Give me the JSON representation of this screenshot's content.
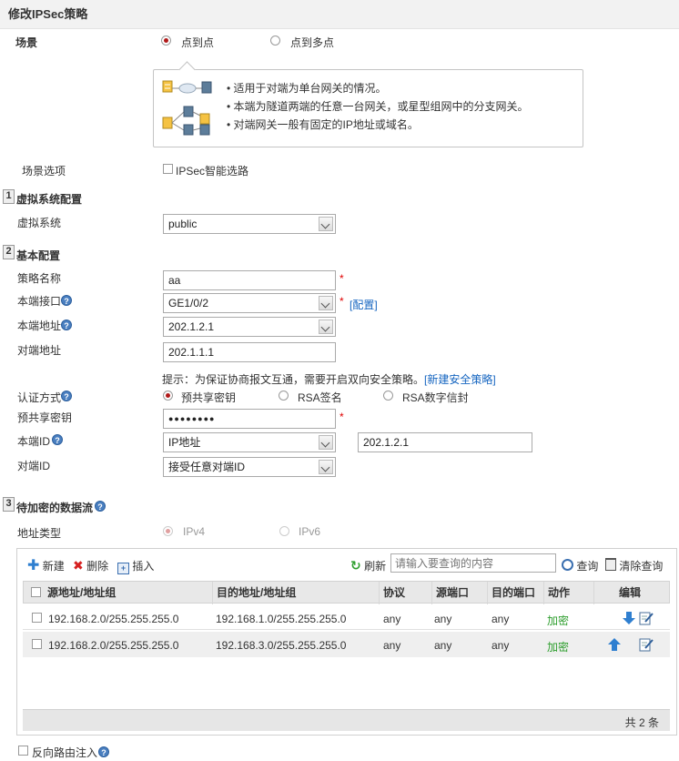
{
  "page_title": "修改IPSec策略",
  "scene": {
    "label": "场景",
    "options": [
      {
        "label": "点到点",
        "selected": true
      },
      {
        "label": "点到多点",
        "selected": false
      }
    ],
    "info_lines": [
      "适用于对端为单台网关的情况。",
      "本端为隧道两端的任意一台网关，或星型组网中的分支网关。",
      "对端网关一般有固定的IP地址或域名。"
    ]
  },
  "scene_option": {
    "label": "场景选项",
    "checkbox_label": "IPSec智能选路",
    "checked": false
  },
  "section1": {
    "num": "1",
    "title": "虚拟系统配置",
    "vsys_label": "虚拟系统",
    "vsys_value": "public"
  },
  "section2": {
    "num": "2",
    "title": "基本配置",
    "policy_name_label": "策略名称",
    "policy_name_value": "aa",
    "local_if_label": "本端接口",
    "local_if_value": "GE1/0/2",
    "config_link": "[配置]",
    "local_addr_label": "本端地址",
    "local_addr_value": "202.1.2.1",
    "peer_addr_label": "对端地址",
    "peer_addr_value": "202.1.1.1",
    "hint_text": "提示：为保证协商报文互通，需要开启双向安全策略。",
    "hint_link": "[新建安全策略]",
    "auth_label": "认证方式",
    "auth_options": [
      {
        "label": "预共享密钥",
        "selected": true
      },
      {
        "label": "RSA签名",
        "selected": false
      },
      {
        "label": "RSA数字信封",
        "selected": false
      }
    ],
    "psk_label": "预共享密钥",
    "psk_value": "●●●●●●●●",
    "local_id_label": "本端ID",
    "local_id_type": "IP地址",
    "local_id_value": "202.1.2.1",
    "peer_id_label": "对端ID",
    "peer_id_value": "接受任意对端ID",
    "required_mark": "*"
  },
  "section3": {
    "num": "3",
    "title": "待加密的数据流",
    "addr_type_label": "地址类型",
    "addr_type_options": [
      {
        "label": "IPv4",
        "selected": true
      },
      {
        "label": "IPv6",
        "selected": false
      }
    ],
    "toolbar": {
      "new_label": "新建",
      "delete_label": "删除",
      "insert_label": "插入",
      "refresh_label": "刷新",
      "search_placeholder": "请输入要查询的内容",
      "query_label": "查询",
      "clear_query_label": "清除查询"
    },
    "table": {
      "headers": [
        "源地址/地址组",
        "目的地址/地址组",
        "协议",
        "源端口",
        "目的端口",
        "动作",
        "编辑"
      ],
      "rows": [
        {
          "src": "192.168.2.0/255.255.255.0",
          "dst": "192.168.1.0/255.255.255.0",
          "proto": "any",
          "sport": "any",
          "dport": "any",
          "action": "加密"
        },
        {
          "src": "192.168.2.0/255.255.255.0",
          "dst": "192.168.3.0/255.255.255.0",
          "proto": "any",
          "sport": "any",
          "dport": "any",
          "action": "加密"
        }
      ],
      "footer": "共 2 条"
    }
  },
  "reverse_route": {
    "label": "反向路由注入",
    "checked": false
  },
  "colors": {
    "accent_red": "#b01818",
    "link_blue": "#1565c0",
    "action_green": "#2e9e2e"
  }
}
